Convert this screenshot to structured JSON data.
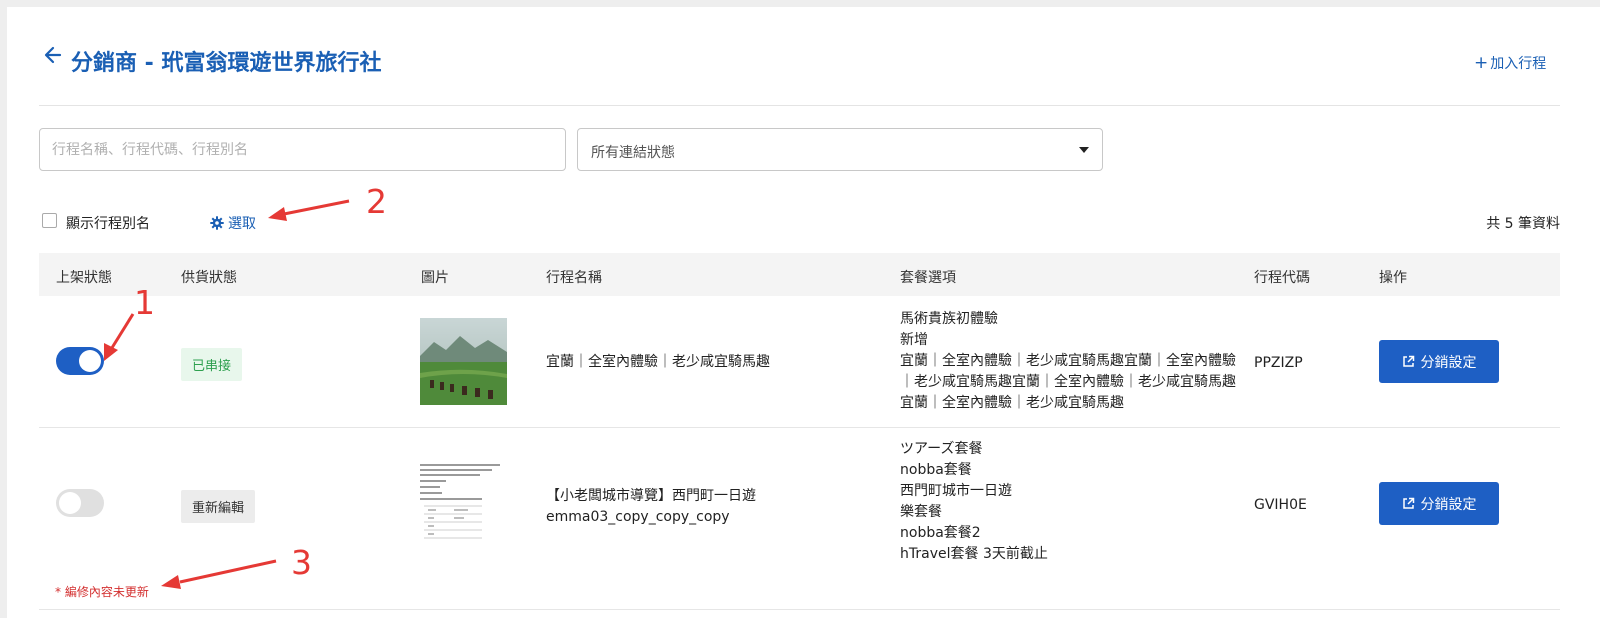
{
  "header": {
    "title_prefix": "分銷商",
    "title_sep": " - ",
    "title_company": "玳富翁環遊世界旅行社",
    "add_trip_label": "加入行程"
  },
  "filters": {
    "search_placeholder": "行程名稱、行程代碼、行程別名",
    "status_value": "所有連結狀態"
  },
  "options": {
    "show_alias_label": "顯示行程別名",
    "select_label": "選取",
    "total_label": "共 5 筆資料"
  },
  "table": {
    "headers": [
      "上架狀態",
      "供貨狀態",
      "圖片",
      "行程名稱",
      "套餐選項",
      "行程代碼",
      "操作"
    ],
    "rows": [
      {
        "published": true,
        "supply_status": "已串接",
        "name": "宜蘭｜全室內體驗｜老少咸宜騎馬趣",
        "packages": [
          "馬術貴族初體驗",
          "新增",
          "宜蘭｜全室內體驗｜老少咸宜騎馬趣宜蘭｜全室內體驗｜老少咸宜騎馬趣宜蘭｜全室內體驗｜老少咸宜騎馬趣宜蘭｜全室內體驗｜老少咸宜騎馬趣"
        ],
        "code": "PPZIZP",
        "action_label": "分銷設定"
      },
      {
        "published": false,
        "supply_status": "重新編輯",
        "name_line1": "【小老闆城市導覽】西門町一日遊",
        "name_line2": "emma03_copy_copy_copy",
        "packages": [
          "ツアーズ套餐",
          "nobba套餐",
          "西門町城市一日遊",
          "樂套餐",
          "nobba套餐2",
          "hTravel套餐 3天前截止"
        ],
        "code": "GVIH0E",
        "action_label": "分銷設定",
        "warning": "* 編修內容未更新"
      }
    ]
  },
  "annotations": [
    "1",
    "2",
    "3"
  ],
  "colors": {
    "primary": "#1e5fc4",
    "title_blue": "#1a5fb4",
    "annotation_red": "#e53935",
    "success_green": "#2ea04f",
    "warning_red": "#d32f2f"
  }
}
